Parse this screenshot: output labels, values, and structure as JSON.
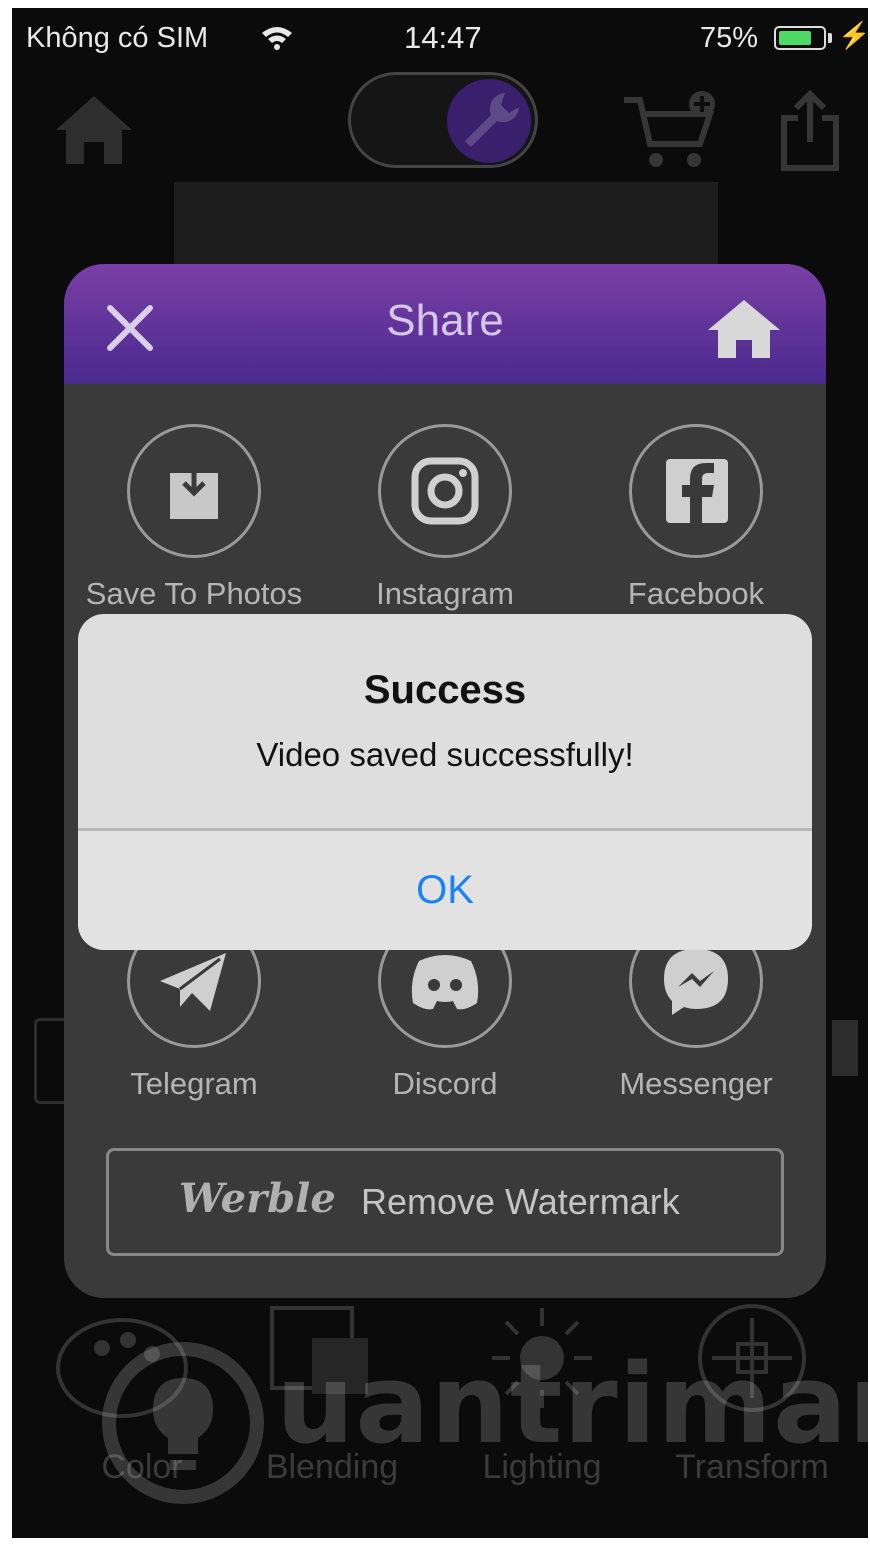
{
  "status_bar": {
    "carrier": "Không có SIM",
    "time": "14:47",
    "battery_percent": "75%",
    "battery_level": 0.75,
    "icons": [
      "wifi-icon",
      "battery-icon",
      "charging-bolt-icon"
    ]
  },
  "app_header": {
    "icons": [
      "home-icon",
      "grid-icon",
      "wrench-icon",
      "cart-add-icon",
      "share-export-icon"
    ]
  },
  "share_sheet": {
    "title": "Share",
    "header_icons": [
      "close-icon",
      "home-icon"
    ],
    "items": [
      {
        "label": "Save To Photos",
        "icon": "save-to-photos-icon"
      },
      {
        "label": "Instagram",
        "icon": "instagram-icon"
      },
      {
        "label": "Facebook",
        "icon": "facebook-icon"
      },
      {
        "label": "Telegram",
        "icon": "telegram-icon"
      },
      {
        "label": "Discord",
        "icon": "discord-icon"
      },
      {
        "label": "Messenger",
        "icon": "messenger-icon"
      }
    ],
    "watermark_button": {
      "logo": "Werble",
      "label": "Remove Watermark"
    }
  },
  "alert": {
    "title": "Success",
    "message": "Video saved successfully!",
    "ok_label": "OK"
  },
  "bottom_toolbar": {
    "items": [
      {
        "label": "Color",
        "icon": "palette-icon"
      },
      {
        "label": "Blending",
        "icon": "blending-icon"
      },
      {
        "label": "Lighting",
        "icon": "sun-icon"
      },
      {
        "label": "Transform",
        "icon": "transform-icon"
      }
    ]
  },
  "site_watermark": "uantrimang",
  "colors": {
    "accent_purple": "#7a3fa6",
    "ios_blue": "#1a82f7",
    "battery_green": "#4cd964"
  }
}
